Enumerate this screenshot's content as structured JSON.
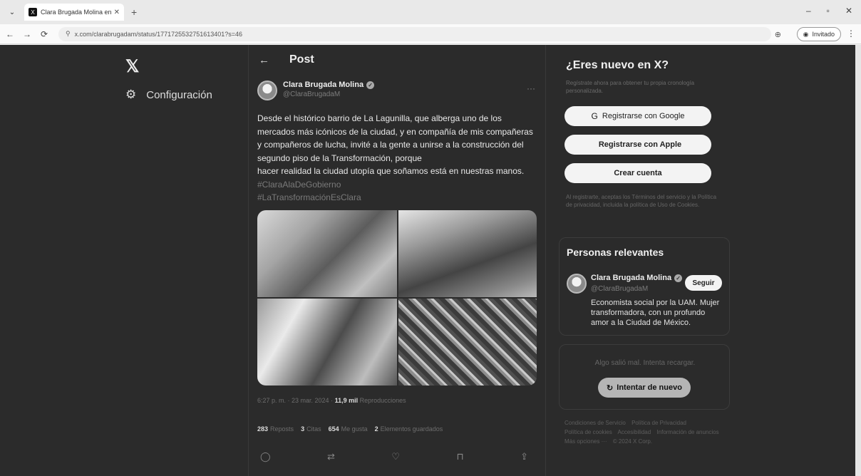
{
  "browser": {
    "tab_menu_glyph": "⌄",
    "tab_favicon": "X",
    "tab_title": "Clara Brugada Molina en X: \"D",
    "tab_close": "✕",
    "new_tab": "+",
    "window_controls": {
      "minimize": "–",
      "maximize": "▫",
      "close": "✕"
    },
    "nav": {
      "back": "←",
      "forward": "→",
      "reload": "⟳"
    },
    "url": "x.com/clarabrugadam/status/1771725532751613401?s=46",
    "zoom_glyph": "⊕",
    "guest_label": "Invitado",
    "menu_glyph": "⋮"
  },
  "left_nav": {
    "logo": "𝕏",
    "settings_icon": "⚙",
    "settings_label": "Configuración"
  },
  "post": {
    "back_glyph": "←",
    "heading": "Post",
    "author_name": "Clara Brugada Molina",
    "verified_glyph": "✓",
    "author_handle": "@ClaraBrugadaM",
    "more_glyph": "···",
    "text_lines": [
      "Desde el histórico barrio de La Lagunilla, que alberga uno de los",
      "mercados más icónicos de la ciudad, y en compañía de mis compañeras",
      "y compañeros de lucha, invité a la gente a unirse a la construcción del",
      "segundo piso de la Transformación, porque",
      "hacer realidad la ciudad utopía que soñamos está en nuestras manos."
    ],
    "hashtags": [
      "#ClaraAlaDeGobierno",
      "#LaTransformaciónEsClara"
    ],
    "timestamp": "6:27 p. m. · 23 mar. 2024 ·",
    "views_count": "11,9 mil",
    "views_label": "Reproducciones",
    "stats": [
      {
        "count": "283",
        "label": "Reposts"
      },
      {
        "count": "3",
        "label": "Citas"
      },
      {
        "count": "654",
        "label": "Me gusta"
      },
      {
        "count": "2",
        "label": "Elementos guardados"
      }
    ],
    "actions": {
      "reply": "◯",
      "repost": "⇄",
      "like": "♡",
      "bookmark": "⊓",
      "share": "⇪"
    }
  },
  "signup": {
    "title": "¿Eres nuevo en X?",
    "subtitle": "Regístrate ahora para obtener tu propia cronología personalizada.",
    "google_icon": "G",
    "google_label": "Registrarse con Google",
    "apple_icon": "",
    "apple_label": "Registrarse con Apple",
    "create_label": "Crear cuenta",
    "legal": "Al registrarte, aceptas los Términos del servicio y la Política de privacidad, incluida la política de Uso de Cookies."
  },
  "relevant": {
    "title": "Personas relevantes",
    "name": "Clara Brugada Molina",
    "handle": "@ClaraBrugadaM",
    "follow_label": "Seguir",
    "bio": "Economista social por la UAM. Mujer transformadora, con un profundo amor a la Ciudad de México."
  },
  "error_box": {
    "message": "Algo salió mal. Intenta recargar.",
    "retry_icon": "↻",
    "retry_label": "Intentar de nuevo"
  },
  "footer_links": [
    "Condiciones de Servicio",
    "Política de Privacidad",
    "Política de cookies",
    "Accesibilidad",
    "Información de anuncios",
    "Más opciones ···",
    "© 2024 X Corp."
  ]
}
